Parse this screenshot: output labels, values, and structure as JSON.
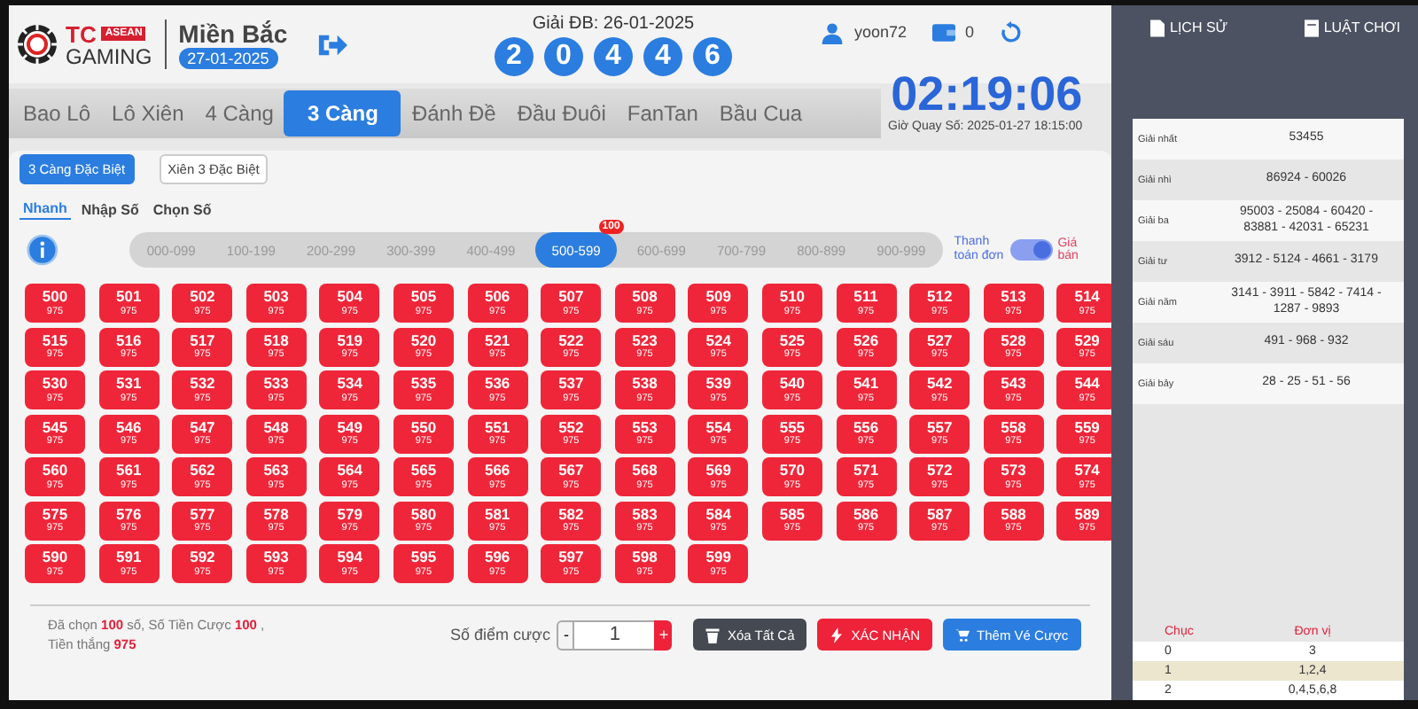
{
  "header": {
    "brand_short": "TC",
    "brand_badge": "ASEAN",
    "brand_name": "GAMING",
    "region": "Miền Bắc",
    "date": "27-01-2025",
    "prize_label": "Giải ĐB: 26-01-2025",
    "prize_digits": [
      "2",
      "0",
      "4",
      "4",
      "6"
    ],
    "username": "yoon72",
    "balance": "0"
  },
  "tabs": [
    {
      "label": "Bao Lô",
      "selected": false
    },
    {
      "label": "Lô Xiên",
      "selected": false
    },
    {
      "label": "4 Càng",
      "selected": false
    },
    {
      "label": "3 Càng",
      "selected": true
    },
    {
      "label": "Đánh Đề",
      "selected": false
    },
    {
      "label": "Đầu Đuôi",
      "selected": false
    },
    {
      "label": "FanTan",
      "selected": false
    },
    {
      "label": "Bầu Cua",
      "selected": false
    }
  ],
  "timer": {
    "countdown": "02:19:06",
    "draw_time": "Giờ Quay Số: 2025-01-27 18:15:00"
  },
  "subtabs": [
    {
      "label": "3 Càng Đặc Biệt",
      "selected": true
    },
    {
      "label": "Xiên 3 Đặc Biệt",
      "selected": false
    }
  ],
  "modes": [
    {
      "label": "Nhanh",
      "selected": true
    },
    {
      "label": "Nhập Số",
      "selected": false
    },
    {
      "label": "Chọn Số",
      "selected": false
    }
  ],
  "ranges": [
    {
      "label": "000-099",
      "selected": false
    },
    {
      "label": "100-199",
      "selected": false
    },
    {
      "label": "200-299",
      "selected": false
    },
    {
      "label": "300-399",
      "selected": false
    },
    {
      "label": "400-499",
      "selected": false
    },
    {
      "label": "500-599",
      "selected": true,
      "badge": "100"
    },
    {
      "label": "600-699",
      "selected": false
    },
    {
      "label": "700-799",
      "selected": false
    },
    {
      "label": "800-899",
      "selected": false
    },
    {
      "label": "900-999",
      "selected": false
    }
  ],
  "payment": {
    "left_label": "Thanh toán đơn",
    "right_label": "Giá bán",
    "on": true
  },
  "numbers": [
    {
      "number": "500",
      "price": "975"
    },
    {
      "number": "501",
      "price": "975"
    },
    {
      "number": "502",
      "price": "975"
    },
    {
      "number": "503",
      "price": "975"
    },
    {
      "number": "504",
      "price": "975"
    },
    {
      "number": "505",
      "price": "975"
    },
    {
      "number": "506",
      "price": "975"
    },
    {
      "number": "507",
      "price": "975"
    },
    {
      "number": "508",
      "price": "975"
    },
    {
      "number": "509",
      "price": "975"
    },
    {
      "number": "510",
      "price": "975"
    },
    {
      "number": "511",
      "price": "975"
    },
    {
      "number": "512",
      "price": "975"
    },
    {
      "number": "513",
      "price": "975"
    },
    {
      "number": "514",
      "price": "975"
    },
    {
      "number": "515",
      "price": "975"
    },
    {
      "number": "516",
      "price": "975"
    },
    {
      "number": "517",
      "price": "975"
    },
    {
      "number": "518",
      "price": "975"
    },
    {
      "number": "519",
      "price": "975"
    },
    {
      "number": "520",
      "price": "975"
    },
    {
      "number": "521",
      "price": "975"
    },
    {
      "number": "522",
      "price": "975"
    },
    {
      "number": "523",
      "price": "975"
    },
    {
      "number": "524",
      "price": "975"
    },
    {
      "number": "525",
      "price": "975"
    },
    {
      "number": "526",
      "price": "975"
    },
    {
      "number": "527",
      "price": "975"
    },
    {
      "number": "528",
      "price": "975"
    },
    {
      "number": "529",
      "price": "975"
    },
    {
      "number": "530",
      "price": "975"
    },
    {
      "number": "531",
      "price": "975"
    },
    {
      "number": "532",
      "price": "975"
    },
    {
      "number": "533",
      "price": "975"
    },
    {
      "number": "534",
      "price": "975"
    },
    {
      "number": "535",
      "price": "975"
    },
    {
      "number": "536",
      "price": "975"
    },
    {
      "number": "537",
      "price": "975"
    },
    {
      "number": "538",
      "price": "975"
    },
    {
      "number": "539",
      "price": "975"
    },
    {
      "number": "540",
      "price": "975"
    },
    {
      "number": "541",
      "price": "975"
    },
    {
      "number": "542",
      "price": "975"
    },
    {
      "number": "543",
      "price": "975"
    },
    {
      "number": "544",
      "price": "975"
    },
    {
      "number": "545",
      "price": "975"
    },
    {
      "number": "546",
      "price": "975"
    },
    {
      "number": "547",
      "price": "975"
    },
    {
      "number": "548",
      "price": "975"
    },
    {
      "number": "549",
      "price": "975"
    },
    {
      "number": "550",
      "price": "975"
    },
    {
      "number": "551",
      "price": "975"
    },
    {
      "number": "552",
      "price": "975"
    },
    {
      "number": "553",
      "price": "975"
    },
    {
      "number": "554",
      "price": "975"
    },
    {
      "number": "555",
      "price": "975"
    },
    {
      "number": "556",
      "price": "975"
    },
    {
      "number": "557",
      "price": "975"
    },
    {
      "number": "558",
      "price": "975"
    },
    {
      "number": "559",
      "price": "975"
    },
    {
      "number": "560",
      "price": "975"
    },
    {
      "number": "561",
      "price": "975"
    },
    {
      "number": "562",
      "price": "975"
    },
    {
      "number": "563",
      "price": "975"
    },
    {
      "number": "564",
      "price": "975"
    },
    {
      "number": "565",
      "price": "975"
    },
    {
      "number": "566",
      "price": "975"
    },
    {
      "number": "567",
      "price": "975"
    },
    {
      "number": "568",
      "price": "975"
    },
    {
      "number": "569",
      "price": "975"
    },
    {
      "number": "570",
      "price": "975"
    },
    {
      "number": "571",
      "price": "975"
    },
    {
      "number": "572",
      "price": "975"
    },
    {
      "number": "573",
      "price": "975"
    },
    {
      "number": "574",
      "price": "975"
    },
    {
      "number": "575",
      "price": "975"
    },
    {
      "number": "576",
      "price": "975"
    },
    {
      "number": "577",
      "price": "975"
    },
    {
      "number": "578",
      "price": "975"
    },
    {
      "number": "579",
      "price": "975"
    },
    {
      "number": "580",
      "price": "975"
    },
    {
      "number": "581",
      "price": "975"
    },
    {
      "number": "582",
      "price": "975"
    },
    {
      "number": "583",
      "price": "975"
    },
    {
      "number": "584",
      "price": "975"
    },
    {
      "number": "585",
      "price": "975"
    },
    {
      "number": "586",
      "price": "975"
    },
    {
      "number": "587",
      "price": "975"
    },
    {
      "number": "588",
      "price": "975"
    },
    {
      "number": "589",
      "price": "975"
    },
    {
      "number": "590",
      "price": "975"
    },
    {
      "number": "591",
      "price": "975"
    },
    {
      "number": "592",
      "price": "975"
    },
    {
      "number": "593",
      "price": "975"
    },
    {
      "number": "594",
      "price": "975"
    },
    {
      "number": "595",
      "price": "975"
    },
    {
      "number": "596",
      "price": "975"
    },
    {
      "number": "597",
      "price": "975"
    },
    {
      "number": "598",
      "price": "975"
    },
    {
      "number": "599",
      "price": "975"
    }
  ],
  "summary": {
    "line_1": "Đã chọn **100** số,  Số Tiền Cược **100** ,",
    "line_2": "Tiền thắng **975**"
  },
  "stake": {
    "label": "Số điểm cược",
    "minus": "-",
    "value": "1",
    "plus": "+"
  },
  "actions": [
    {
      "label": "Xóa Tất Cả",
      "kind": "clear"
    },
    {
      "label": "XÁC NHẬN",
      "kind": "confirm"
    },
    {
      "label": "Thêm Vé Cược",
      "kind": "cart"
    }
  ],
  "side_tabs": [
    {
      "label": "LỊCH SỬ",
      "kind": "history"
    },
    {
      "label": "LUẬT CHƠI",
      "kind": "rules"
    }
  ],
  "results": [
    {
      "prize": "Giải nhất",
      "numbers": "53455"
    },
    {
      "prize": "Giải nhì",
      "numbers": "86924 - 60026"
    },
    {
      "prize": "Giải ba",
      "numbers": "95003 - 25084 - 60420 - 83881 - 42031 - 65231"
    },
    {
      "prize": "Giải tư",
      "numbers": "3912 - 5124 - 4661 - 3179"
    },
    {
      "prize": "Giải năm",
      "numbers": "3141 - 3911 - 5842 - 7414 - 1287 - 9893"
    },
    {
      "prize": "Giải sáu",
      "numbers": "491 - 968 - 932"
    },
    {
      "prize": "Giải bảy",
      "numbers": "28 - 25 - 51 - 56"
    }
  ],
  "stats": {
    "columns": [
      "Chục",
      "Đơn vị"
    ],
    "rows": [
      [
        "0",
        "3"
      ],
      [
        "1",
        "1,2,4"
      ],
      [
        "2",
        "0,4,5,6,8"
      ]
    ]
  }
}
